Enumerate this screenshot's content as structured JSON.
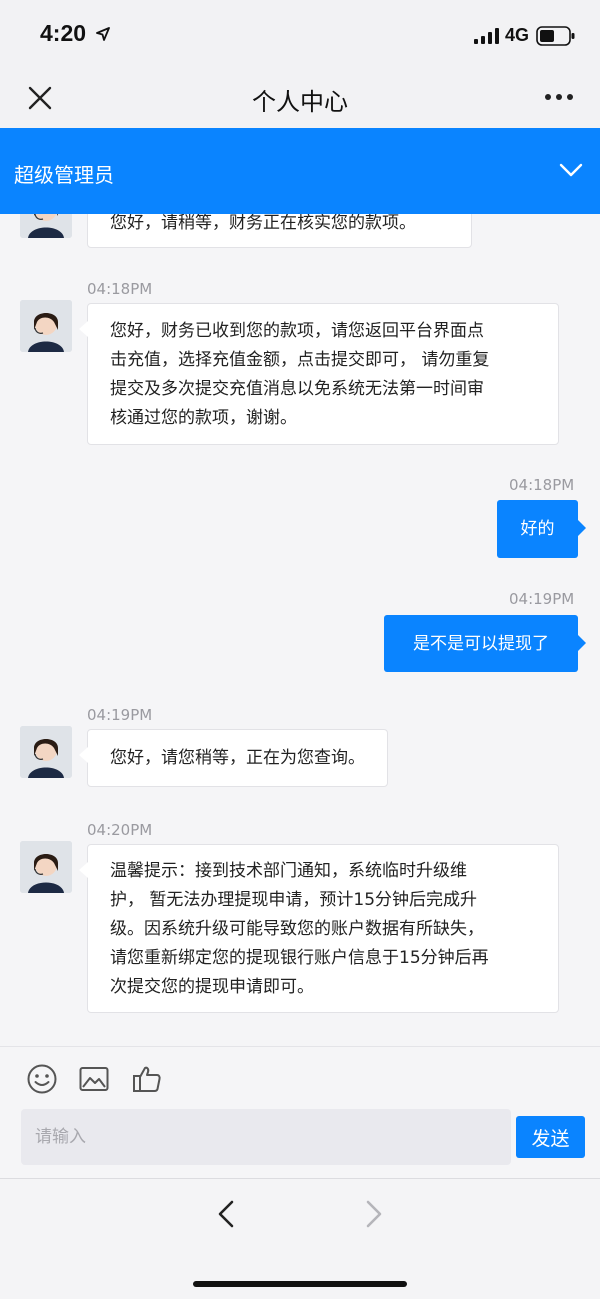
{
  "status_bar": {
    "time": "4:20",
    "network": "4G"
  },
  "nav": {
    "title": "个人中心"
  },
  "banner": {
    "admin_name": "超级管理员"
  },
  "messages": [
    {
      "side": "left",
      "text": "您好，请稍等，财务正在核实您的款项。"
    },
    {
      "side": "left",
      "time": "04:18PM",
      "lines": [
        "您好，财务已收到您的款项，请您返回平台界面点",
        "击充值，选择充值金额，点击提交即可， 请勿重复",
        "提交及多次提交充值消息以免系统无法第一时间审",
        "核通过您的款项，谢谢。"
      ]
    },
    {
      "side": "right",
      "time": "04:18PM",
      "text": "好的"
    },
    {
      "side": "right",
      "time": "04:19PM",
      "text": "是不是可以提现了"
    },
    {
      "side": "left",
      "time": "04:19PM",
      "text": "您好，请您稍等，正在为您查询。"
    },
    {
      "side": "left",
      "time": "04:20PM",
      "lines": [
        "温馨提示：接到技术部门通知，系统临时升级维",
        "护， 暂无法办理提现申请，预计15分钟后完成升",
        "级。因系统升级可能导致您的账户数据有所缺失，",
        "请您重新绑定您的提现银行账户信息于15分钟后再",
        "次提交您的提现申请即可。"
      ]
    }
  ],
  "composer": {
    "placeholder": "请输入",
    "value": "",
    "send_label": "发送"
  },
  "icons": {
    "emoji": "smiley-icon",
    "image": "image-icon",
    "like": "thumbs-up-icon",
    "close": "close-icon",
    "more": "more-dots-icon",
    "chevron": "chevron-down-icon",
    "back": "chevron-left-icon",
    "forward": "chevron-right-icon"
  },
  "colors": {
    "accent": "#0a84ff",
    "background": "#f5f5f7",
    "bubble_left": "#ffffff"
  }
}
